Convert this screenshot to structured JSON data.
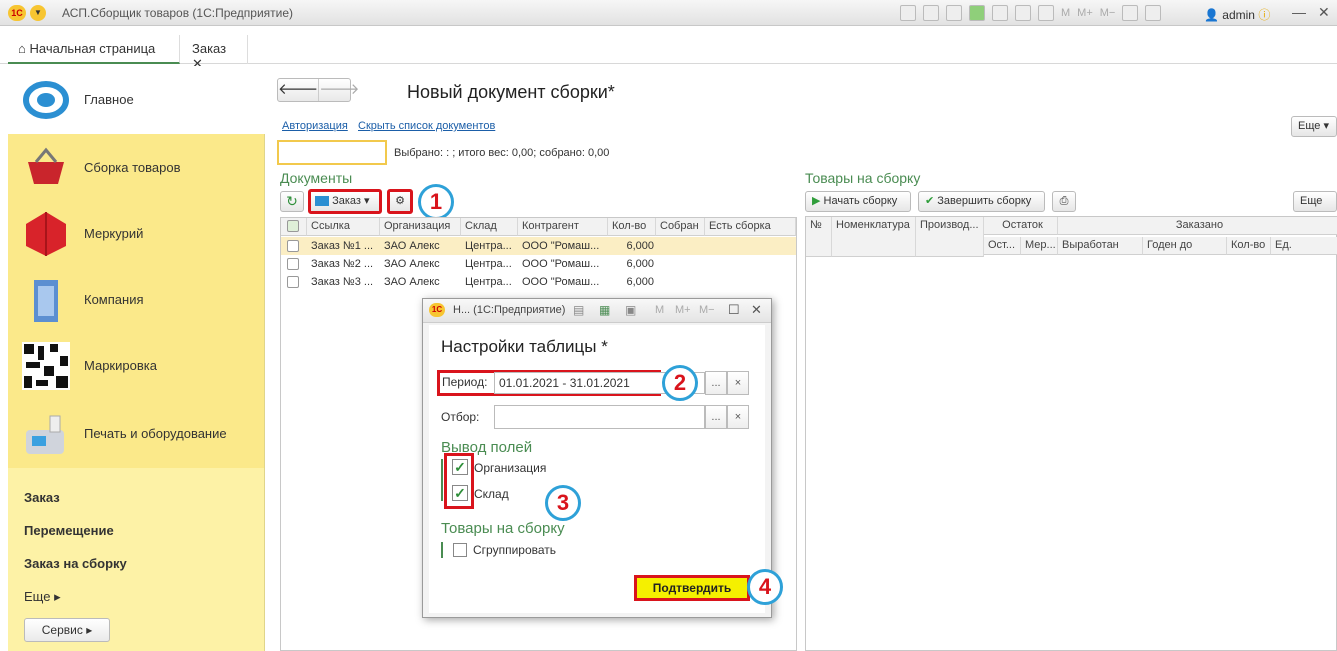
{
  "app": {
    "title": "АСП.Сборщик товаров  (1С:Предприятие)",
    "user": "admin",
    "m_buttons": [
      "M",
      "M+",
      "M−"
    ]
  },
  "tabs": [
    {
      "label": "Начальная страница"
    },
    {
      "label": "Заказ"
    }
  ],
  "sidebar": {
    "items": [
      {
        "label": "Главное"
      },
      {
        "label": "Сборка товаров"
      },
      {
        "label": "Меркурий"
      },
      {
        "label": "Компания"
      },
      {
        "label": "Маркировка"
      },
      {
        "label": "Печать и оборудование"
      }
    ],
    "links": [
      "Заказ",
      "Перемещение",
      "Заказ на сборку"
    ],
    "more": "Еще",
    "service": "Сервис"
  },
  "doc": {
    "title": "Новый документ сборки*",
    "auth_link": "Авторизация",
    "hide_link": "Скрыть список документов",
    "more": "Еще",
    "summary": "Выбрано: : ; итого вес: 0,00; собрано: 0,00"
  },
  "documents": {
    "title": "Документы",
    "type_button": "Заказ",
    "columns": [
      "Ссылка",
      "Организация",
      "Склад",
      "Контрагент",
      "Кол-во",
      "Собран",
      "Есть сборка"
    ],
    "rows": [
      {
        "link": "Заказ №1 ...",
        "org": "ЗАО Алекс",
        "warehouse": "Центра...",
        "partner": "ООО \"Ромаш...",
        "qty": "6,000"
      },
      {
        "link": "Заказ №2 ...",
        "org": "ЗАО Алекс",
        "warehouse": "Центра...",
        "partner": "ООО \"Ромаш...",
        "qty": "6,000"
      },
      {
        "link": "Заказ №3 ...",
        "org": "ЗАО Алекс",
        "warehouse": "Центра...",
        "partner": "ООО \"Ромаш...",
        "qty": "6,000"
      }
    ]
  },
  "goods": {
    "title": "Товары на сборку",
    "start_button": "Начать сборку",
    "finish_button": "Завершить сборку",
    "more": "Еще",
    "columns": [
      "№",
      "Номенклатура",
      "Производ...",
      "Остаток",
      "Заказано"
    ],
    "subcolumns": [
      "Ост...",
      "Мер...",
      "Выработан",
      "Годен до",
      "Кол-во",
      "Ед."
    ]
  },
  "dialog": {
    "window_title": "Н...  (1С:Предприятие)",
    "title": "Настройки таблицы *",
    "period_label": "Период:",
    "period_value": "01.01.2021 - 31.01.2021",
    "filter_label": "Отбор:",
    "filter_value": "",
    "fields_section": "Вывод полей",
    "fields": [
      {
        "label": "Организация",
        "checked": true
      },
      {
        "label": "Склад",
        "checked": true
      }
    ],
    "goods_section": "Товары на сборку",
    "group_label": "Сгруппировать",
    "confirm": "Подтвердить",
    "select_btn": "...",
    "clear_btn": "×"
  },
  "annotations": [
    "1",
    "2",
    "3",
    "4"
  ],
  "colors": {
    "accent_green": "#4a8c52",
    "highlight_red": "#d9141c",
    "circle_blue": "#2ea1d8",
    "sidebar_yellow": "#fdf2a6",
    "confirm_yellow": "#f5f000"
  }
}
